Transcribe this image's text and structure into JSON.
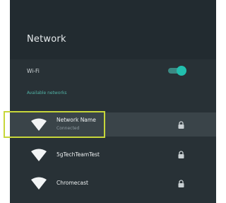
{
  "screen": {
    "title": "Network"
  },
  "wifi": {
    "label": "Wi-Fi",
    "enabled": true
  },
  "section": {
    "available_networks": "Available networks"
  },
  "networks": [
    {
      "name": "Network Name",
      "status": "Connected",
      "icon": "wifi-icon",
      "locked": true,
      "selected": true
    },
    {
      "name": "5gTechTeamTest",
      "status": "",
      "icon": "wifi-icon",
      "locked": true,
      "selected": false
    },
    {
      "name": "Chromecast",
      "status": "",
      "icon": "wifi-icon",
      "locked": true,
      "selected": false
    }
  ],
  "colors": {
    "panel_background": "#283136",
    "accent": "#22bfae",
    "highlight_border": "#c7d63a",
    "selected_row": "#3a4449"
  }
}
